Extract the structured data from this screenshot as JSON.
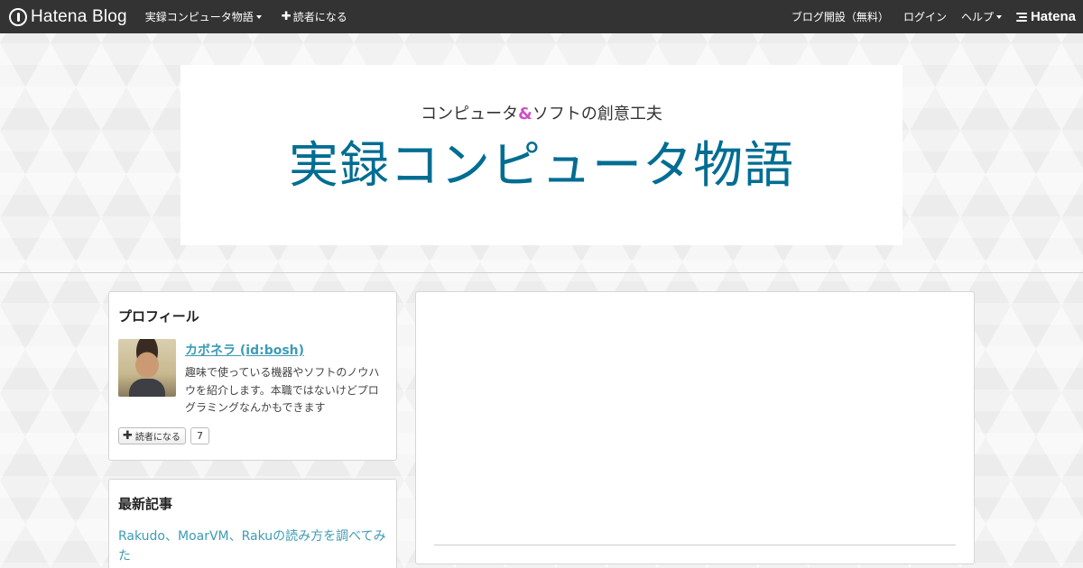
{
  "topbar": {
    "brand": "Hatena Blog",
    "blog_menu": "実録コンピュータ物語",
    "subscribe": "読者になる",
    "open_blog": "ブログ開設（無料）",
    "login": "ログイン",
    "help": "ヘルプ",
    "hatena": "Hatena"
  },
  "header": {
    "tagline_pre": "コンピュータ",
    "tagline_amp": "&",
    "tagline_post": "ソフトの創意工夫",
    "title": "実録コンピュータ物語"
  },
  "profile": {
    "heading": "プロフィール",
    "name": "カボネラ (id:bosh)",
    "description": "趣味で使っている機器やソフトのノウハウを紹介します。本職ではないけどプログラミングなんかもできます",
    "subscribe_label": "読者になる",
    "subscriber_count": "7"
  },
  "recent": {
    "heading": "最新記事",
    "items": [
      "Rakudo、MoarVM、Rakuの読み方を調べてみた"
    ]
  },
  "colors": {
    "topbar": "#333333",
    "title": "#006d92",
    "link": "#3d9bb5",
    "amp": "#d04fc2"
  }
}
